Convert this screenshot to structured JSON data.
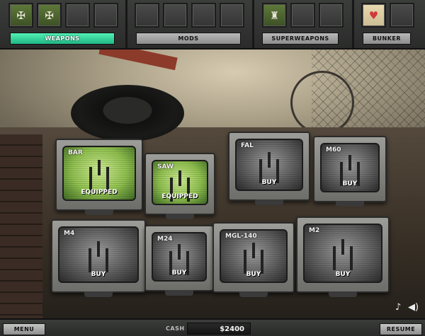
{
  "tabs": {
    "weapons": "WEAPONS",
    "mods": "MODS",
    "superweapons": "SUPERWEAPONS",
    "bunker": "BUNKER"
  },
  "slot_icons": {
    "weapons": [
      "rifle-icon",
      "rifle-icon",
      "empty",
      "empty"
    ],
    "mods": [
      "empty",
      "empty",
      "empty",
      "empty"
    ],
    "superweapons": [
      "soldier-icon",
      "empty",
      "empty"
    ],
    "bunker": [
      "heart-icon",
      "empty"
    ]
  },
  "weapons": [
    {
      "label": "BAR",
      "status": "EQUIPPED",
      "screen": "green"
    },
    {
      "label": "SAW",
      "status": "EQUIPPED",
      "screen": "green"
    },
    {
      "label": "FAL",
      "status": "BUY",
      "screen": "gray"
    },
    {
      "label": "M60",
      "status": "BUY",
      "screen": "gray"
    },
    {
      "label": "M4",
      "status": "BUY",
      "screen": "gray"
    },
    {
      "label": "M24",
      "status": "BUY",
      "screen": "gray"
    },
    {
      "label": "MGL-140",
      "status": "BUY",
      "screen": "gray"
    },
    {
      "label": "M2",
      "status": "BUY",
      "screen": "gray"
    }
  ],
  "bottom": {
    "menu_label": "MENU",
    "cash_label": "CASH",
    "cash_value": "$2400",
    "resume_label": "RESUME"
  },
  "audio_icons": [
    "music-note-icon",
    "speaker-icon"
  ],
  "colors": {
    "active_tab": "#2fd89b",
    "equipped_screen": "#8fbf4e"
  }
}
